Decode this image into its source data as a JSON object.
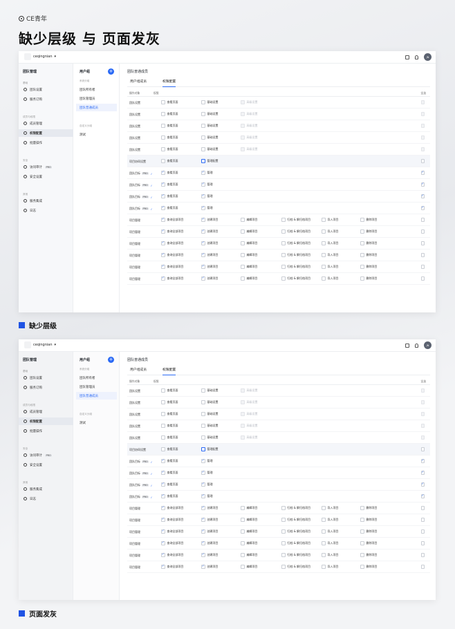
{
  "brand": "CE青年",
  "page_title": "缺少层级 与 页面发灰",
  "captions": [
    "缺少层级",
    "页面发灰"
  ],
  "colors": {
    "accent": "#2b6af5",
    "caption_square": "#1f53e4"
  },
  "topbar": {
    "org_name": "ceqingnian",
    "avatar": "JN"
  },
  "sidebar": {
    "title": "团队管理",
    "groups": [
      "基础",
      "成员与权限",
      "安全",
      "其他"
    ],
    "items": [
      {
        "label": "团队设置",
        "icon": "gear-icon"
      },
      {
        "label": "服务订购",
        "icon": "cart-icon"
      },
      {
        "label": "成员管理",
        "icon": "user-icon"
      },
      {
        "label": "权限配置",
        "icon": "users-icon"
      },
      {
        "label": "批量操作",
        "icon": "batch-icon"
      },
      {
        "label": "访问审计",
        "icon": "audit-icon",
        "badge": "PRO"
      },
      {
        "label": "安全设置",
        "icon": "shield-icon"
      },
      {
        "label": "服务集成",
        "icon": "plug-icon"
      },
      {
        "label": "日志",
        "icon": "log-icon"
      }
    ]
  },
  "usergroups": {
    "title": "用户组",
    "add": "+",
    "system_group": "系统分组",
    "custom_group": "自定义分组",
    "items": [
      "团队所有者",
      "团队管理员",
      "团队普通成员"
    ],
    "custom_items": [
      "测试"
    ]
  },
  "main": {
    "title": "团队普通成员",
    "tabs": [
      "用户组成员",
      "权限配置"
    ],
    "headers": {
      "object": "操作对象",
      "perm": "权限",
      "all": "全选"
    },
    "rows": [
      {
        "name": "团队设置",
        "perms": [
          [
            "查看页面",
            "off"
          ],
          [
            "基础设置",
            "off"
          ],
          [
            "高级设置",
            "dis"
          ]
        ],
        "all": "dis"
      },
      {
        "name": "团队设置",
        "perms": [
          [
            "查看页面",
            "off"
          ],
          [
            "基础设置",
            "off"
          ],
          [
            "高级设置",
            "dis"
          ]
        ],
        "all": "dis"
      },
      {
        "name": "团队设置",
        "perms": [
          [
            "查看页面",
            "off"
          ],
          [
            "基础设置",
            "off"
          ],
          [
            "高级设置",
            "dis"
          ]
        ],
        "all": "dis"
      },
      {
        "name": "团队设置",
        "perms": [
          [
            "查看页面",
            "off"
          ],
          [
            "基础设置",
            "off"
          ],
          [
            "高级设置",
            "dis"
          ]
        ],
        "all": "dis"
      },
      {
        "name": "团队设置",
        "perms": [
          [
            "查看页面",
            "off"
          ],
          [
            "基础设置",
            "off"
          ],
          [
            "高级设置",
            "dis"
          ]
        ],
        "all": "dis"
      },
      {
        "name": "项目协同设置",
        "perms": [
          [
            "查看页面",
            "off"
          ],
          [
            "管理配置",
            "blue"
          ]
        ],
        "all": "off",
        "highlight": true
      },
      {
        "name": "团队目标",
        "pro": "PRO",
        "perms": [
          [
            "查看页面",
            "on"
          ],
          [
            "管理",
            "on"
          ]
        ],
        "all": "on"
      },
      {
        "name": "团队目标",
        "pro": "PRO",
        "perms": [
          [
            "查看页面",
            "on"
          ],
          [
            "管理",
            "on"
          ]
        ],
        "all": "on"
      },
      {
        "name": "团队目标",
        "pro": "PRO",
        "perms": [
          [
            "查看页面",
            "on"
          ],
          [
            "管理",
            "on"
          ]
        ],
        "all": "on"
      },
      {
        "name": "团队目标",
        "pro": "PRO",
        "perms": [
          [
            "查看页面",
            "on"
          ],
          [
            "管理",
            "on"
          ]
        ],
        "all": "on"
      },
      {
        "name": "项目管理",
        "perms": [
          [
            "查询全部项目",
            "on"
          ],
          [
            "创建项目",
            "on"
          ],
          [
            "编辑项目",
            "off"
          ],
          [
            "归档 & 解归档项目",
            "off"
          ],
          [
            "导入项目",
            "off"
          ],
          [
            "删除项目",
            "off"
          ]
        ],
        "all": "off"
      },
      {
        "name": "项目管理",
        "perms": [
          [
            "查询全部项目",
            "on"
          ],
          [
            "创建项目",
            "on"
          ],
          [
            "编辑项目",
            "off"
          ],
          [
            "归档 & 解归档项目",
            "off"
          ],
          [
            "导入项目",
            "off"
          ],
          [
            "删除项目",
            "off"
          ]
        ],
        "all": "off"
      },
      {
        "name": "项目管理",
        "perms": [
          [
            "查询全部项目",
            "on"
          ],
          [
            "创建项目",
            "on"
          ],
          [
            "编辑项目",
            "off"
          ],
          [
            "归档 & 解归档项目",
            "off"
          ],
          [
            "导入项目",
            "off"
          ],
          [
            "删除项目",
            "off"
          ]
        ],
        "all": "off"
      },
      {
        "name": "项目管理",
        "perms": [
          [
            "查询全部项目",
            "on"
          ],
          [
            "创建项目",
            "on"
          ],
          [
            "编辑项目",
            "off"
          ],
          [
            "归档 & 解归档项目",
            "off"
          ],
          [
            "导入项目",
            "off"
          ],
          [
            "删除项目",
            "off"
          ]
        ],
        "all": "off"
      },
      {
        "name": "项目管理",
        "perms": [
          [
            "查询全部项目",
            "on"
          ],
          [
            "创建项目",
            "on"
          ],
          [
            "编辑项目",
            "off"
          ],
          [
            "归档 & 解归档项目",
            "off"
          ],
          [
            "导入项目",
            "off"
          ],
          [
            "删除项目",
            "off"
          ]
        ],
        "all": "off"
      },
      {
        "name": "项目管理",
        "perms": [
          [
            "查询全部项目",
            "on"
          ],
          [
            "创建项目",
            "on"
          ],
          [
            "编辑项目",
            "off"
          ],
          [
            "归档 & 解归档项目",
            "off"
          ],
          [
            "导入项目",
            "off"
          ],
          [
            "删除项目",
            "off"
          ]
        ],
        "all": "off"
      }
    ]
  }
}
